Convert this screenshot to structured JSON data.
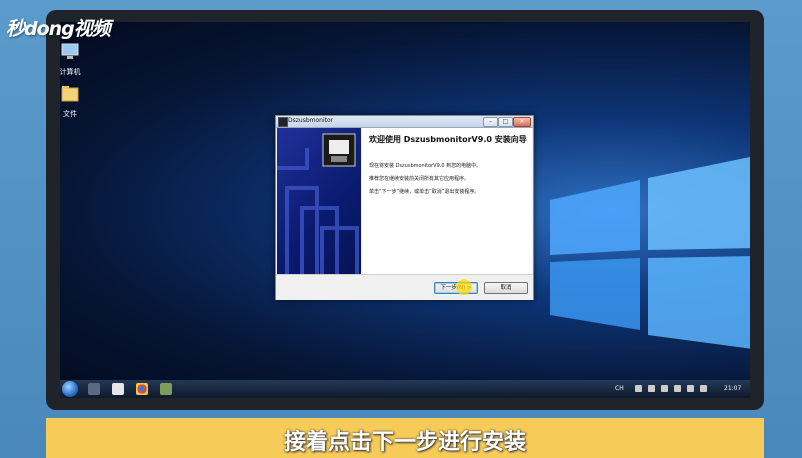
{
  "brand": {
    "logo_text": "秒dong视频"
  },
  "desktop": {
    "icons": [
      {
        "label": "计算机"
      },
      {
        "label": "文件"
      }
    ]
  },
  "dialog": {
    "title": "Dszusbmonitor",
    "heading": "欢迎使用 DszusbmonitorV9.0 安装向导",
    "paragraphs": [
      "现在将安装 DszusbmonitorV9.0 到您的电脑中。",
      "推荐您在继续安装前关闭所有其它应用程序。",
      "单击“下一步”继续，或单击“取消”退出安装程序。"
    ],
    "next_label": "下一步(N) >",
    "cancel_label": "取消"
  },
  "taskbar": {
    "tray_lang": "CH",
    "clock": "21:07"
  },
  "caption": {
    "text": "接着点击下一步进行安装"
  },
  "colors": {
    "accent": "#f7cb58",
    "screen": "#0d3475",
    "wizard_side": "#0a1a6e"
  }
}
